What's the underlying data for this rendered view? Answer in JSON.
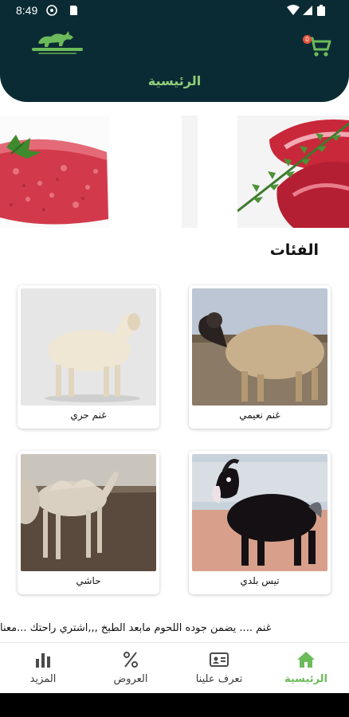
{
  "status_bar": {
    "time": "8:49"
  },
  "header": {
    "title": "الرئيسية",
    "cart_count": "0"
  },
  "categories_title": "الفئات",
  "categories": [
    {
      "label": "غنم نعيمي",
      "icon": "naimi-sheep-image"
    },
    {
      "label": "غنم حري",
      "icon": "harri-sheep-image"
    },
    {
      "label": "تيس بلدي",
      "icon": "baladi-goat-image"
    },
    {
      "label": "حاشي",
      "icon": "camel-calf-image"
    }
  ],
  "marquee": {
    "text": "غنم    ....   يضمن جوده اللحوم مابعد الطبخ ,,,اشتري راحتك ...معنا"
  },
  "bottom_nav": {
    "items": [
      {
        "label": "الرئيسية",
        "icon": "home-icon",
        "active": true
      },
      {
        "label": "تعرف علينا",
        "icon": "id-card-icon",
        "active": false
      },
      {
        "label": "العروض",
        "icon": "percent-icon",
        "active": false
      },
      {
        "label": "المزيد",
        "icon": "bar-chart-icon",
        "active": false
      }
    ]
  },
  "colors": {
    "header_bg": "#0b2b34",
    "accent_green": "#6cbb5a",
    "title_green": "#8fce7a"
  }
}
